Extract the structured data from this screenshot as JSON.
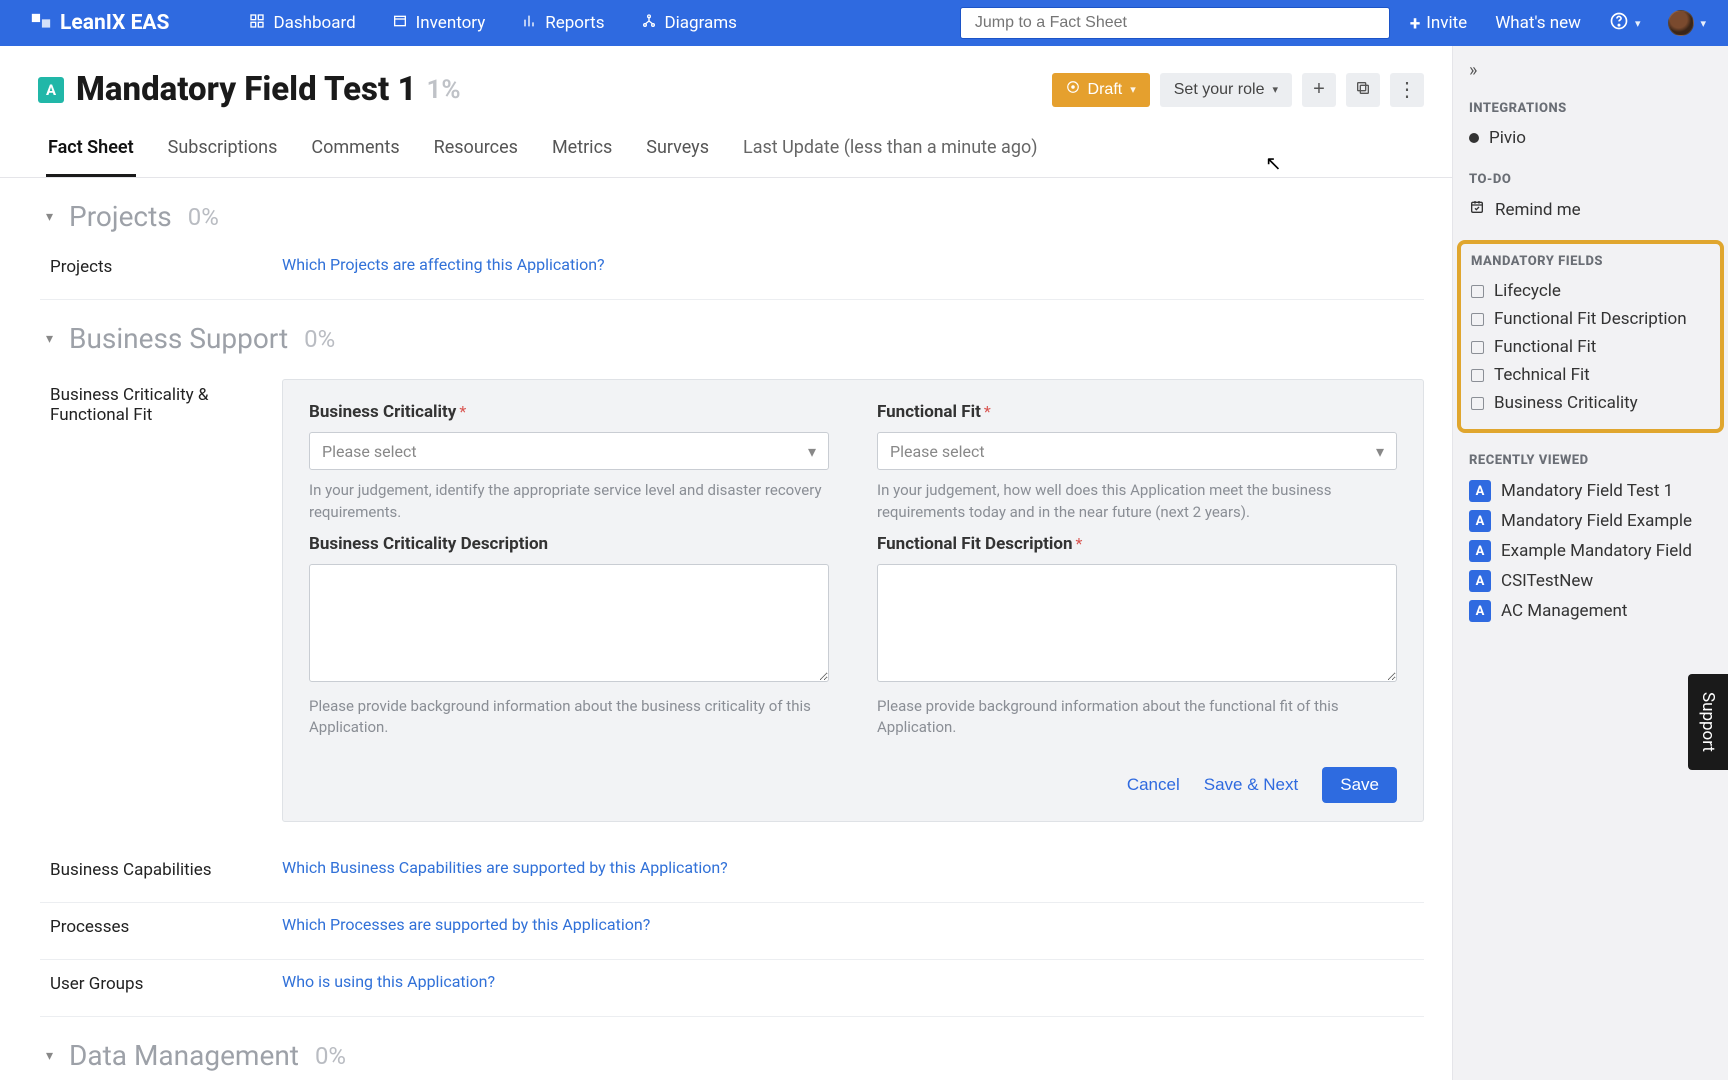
{
  "brand": "LeanIX EAS",
  "nav": {
    "dashboard": "Dashboard",
    "inventory": "Inventory",
    "reports": "Reports",
    "diagrams": "Diagrams"
  },
  "search_placeholder": "Jump to a Fact Sheet",
  "topright": {
    "invite": "Invite",
    "whatsnew": "What's new"
  },
  "page": {
    "badge": "A",
    "title": "Mandatory Field Test 1",
    "pct": "1%",
    "draft": "Draft",
    "role": "Set your role"
  },
  "tabs": {
    "factsheet": "Fact Sheet",
    "subscriptions": "Subscriptions",
    "comments": "Comments",
    "resources": "Resources",
    "metrics": "Metrics",
    "surveys": "Surveys",
    "lastupdate": "Last Update (less than a minute ago)"
  },
  "sections": {
    "projects": {
      "title": "Projects",
      "pct": "0%",
      "row_label": "Projects",
      "row_q": "Which Projects are affecting this Application?"
    },
    "bizsupport": {
      "title": "Business Support",
      "pct": "0%"
    },
    "datamgmt": {
      "title": "Data Management",
      "pct": "0%"
    }
  },
  "form": {
    "group_label": "Business Criticality & Functional Fit",
    "bc_label": "Business Criticality",
    "bc_placeholder": "Please select",
    "bc_help": "In your judgement, identify the appropriate service level and disaster recovery requirements.",
    "bcdesc_label": "Business Criticality Description",
    "bcdesc_help": "Please provide background information about the business criticality of this Application.",
    "ff_label": "Functional Fit",
    "ff_placeholder": "Please select",
    "ff_help": "In your judgement, how well does this Application meet the business requirements today and in the near future (next 2 years).",
    "ffdesc_label": "Functional Fit Description",
    "ffdesc_help": "Please provide background information about the functional fit of this Application.",
    "cancel": "Cancel",
    "savenext": "Save & Next",
    "save": "Save"
  },
  "rows": {
    "bc": {
      "label": "Business Capabilities",
      "q": "Which Business Capabilities are supported by this Application?"
    },
    "proc": {
      "label": "Processes",
      "q": "Which Processes are supported by this Application?"
    },
    "ug": {
      "label": "User Groups",
      "q": "Who is using this Application?"
    }
  },
  "right": {
    "integrations": "INTEGRATIONS",
    "pivio": "Pivio",
    "todo": "TO-DO",
    "remind": "Remind me",
    "mandatory": "MANDATORY FIELDS",
    "mf": [
      "Lifecycle",
      "Functional Fit Description",
      "Functional Fit",
      "Technical Fit",
      "Business Criticality"
    ],
    "recent": "RECENTLY VIEWED",
    "rv": [
      "Mandatory Field Test 1",
      "Mandatory Field Example",
      "Example Mandatory Field",
      "CSITestNew",
      "AC Management"
    ],
    "rv_badge": "A",
    "support": "Support"
  }
}
